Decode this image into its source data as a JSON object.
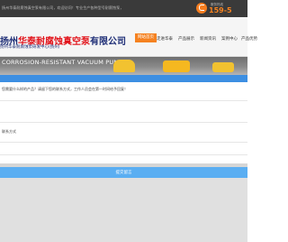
{
  "topbar": {
    "text": "扬州华泰耐腐蚀真空泵有限公司，欢迎访问！专业生产各种型号耐腐蚀泵，"
  },
  "hotline": {
    "label": "服务热线",
    "number": "159-5"
  },
  "header": {
    "company_prefix": "扬州",
    "company_highlight": "华泰耐腐蚀真空泵",
    "company_suffix": "有限公司",
    "company_sub": "扬州华泰耐腐蚀泵研发中心(扬州)"
  },
  "nav": {
    "items": [
      "网站首页",
      "走进华泰",
      "产品展示",
      "新闻资讯",
      "案例中心",
      "产品优势"
    ]
  },
  "banner": {
    "text": "CORROSION-RESISTANT VACUUM PUMP"
  },
  "form": {
    "question": "您需要什么样的产品？请留下您的联系方式，工作人员会在第一时间给予回复！",
    "contact_label": "联系方式",
    "submit_label": "提交留言"
  },
  "colors": {
    "accent": "#f58220",
    "brand_blue": "#1f2f77",
    "form_header": "#3d8fe2",
    "submit": "#5aaef2"
  }
}
